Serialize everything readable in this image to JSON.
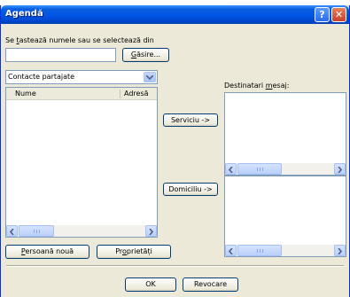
{
  "window": {
    "title": "Agendă",
    "help_glyph": "?",
    "close_glyph": "✕"
  },
  "search": {
    "prompt_prefix": "Se ",
    "prompt_accel": "t",
    "prompt_rest": "astează numele sau se selectează din",
    "value": "",
    "find_accel": "G",
    "find_rest": "ăsire..."
  },
  "source": {
    "selected": "Contacte partajate"
  },
  "contacts_list": {
    "columns": [
      "Nume",
      "Adresă"
    ]
  },
  "recipients": {
    "label_prefix": "Destinatari ",
    "label_accel": "m",
    "label_rest": "esaj:",
    "to_button": "Serviciu ->",
    "cc_button": "Domiciliu ->"
  },
  "actions": {
    "new_contact_accel": "P",
    "new_contact_rest": "ersoană nouă",
    "properties_prefix": "Pr",
    "properties_accel": "o",
    "properties_rest": "prietăți",
    "ok": "OK",
    "cancel": "Revocare"
  },
  "colors": {
    "titlebar": "#0055e5",
    "dialog_bg": "#ece9d8",
    "field_border": "#7f9db9",
    "scroll_button": "#b9d0fb"
  }
}
